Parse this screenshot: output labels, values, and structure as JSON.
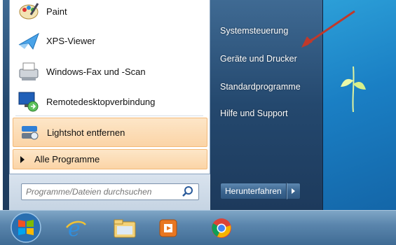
{
  "programs": [
    {
      "label": "Paint",
      "icon": "paint-icon"
    },
    {
      "label": "XPS-Viewer",
      "icon": "xps-viewer-icon"
    },
    {
      "label": "Windows-Fax und -Scan",
      "icon": "fax-scan-icon"
    },
    {
      "label": "Remotedesktopverbindung",
      "icon": "remote-desktop-icon"
    },
    {
      "label": "Lightshot entfernen",
      "icon": "lightshot-icon",
      "highlighted": true
    }
  ],
  "all_programs_label": "Alle Programme",
  "search": {
    "placeholder": "Programme/Dateien durchsuchen"
  },
  "right_links": [
    {
      "label": "Systemsteuerung"
    },
    {
      "label": "Geräte und Drucker"
    },
    {
      "label": "Standardprogramme"
    },
    {
      "label": "Hilfe und Support"
    }
  ],
  "shutdown": {
    "label": "Herunterfahren"
  },
  "taskbar": [
    "start-orb-icon",
    "internet-explorer-icon",
    "file-explorer-icon",
    "media-player-icon",
    "chrome-icon"
  ],
  "colors": {
    "highlight": "#fbd4a6",
    "menu_blue": "#24486e",
    "annotation": "#c0392b"
  }
}
